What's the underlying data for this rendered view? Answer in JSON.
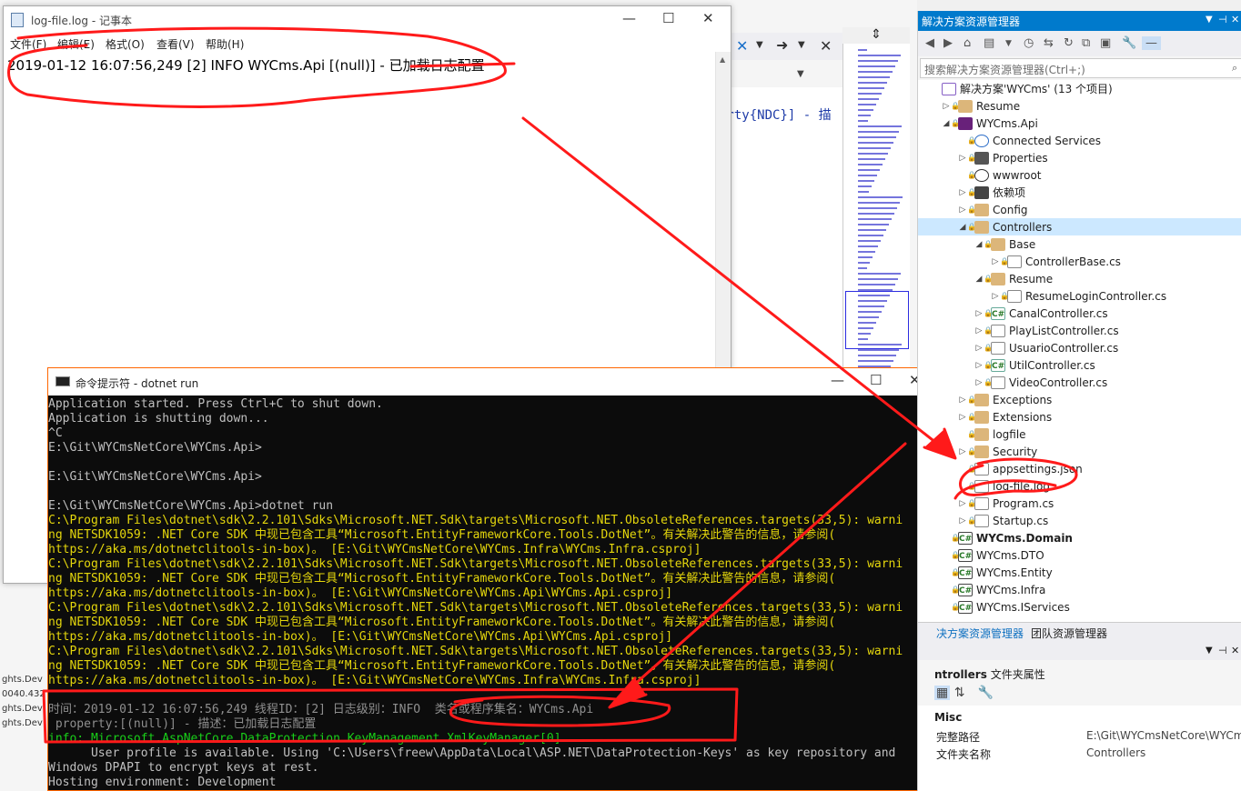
{
  "notepad": {
    "title": "log-file.log - 记事本",
    "menu": [
      "文件(F)",
      "编辑(E)",
      "格式(O)",
      "查看(V)",
      "帮助(H)"
    ],
    "content": "2019-01-12 16:07:56,249 [2] INFO  WYCms.Api [(null)] - 已加载日志配置"
  },
  "editor": {
    "code_fragment": "erty{NDC}] - 描"
  },
  "console": {
    "title": "命令提示符 - dotnet  run",
    "lines": [
      {
        "t": "Application started. Press Ctrl+C to shut down.",
        "c": ""
      },
      {
        "t": "Application is shutting down...",
        "c": ""
      },
      {
        "t": "^C",
        "c": ""
      },
      {
        "t": "E:\\Git\\WYCmsNetCore\\WYCms.Api>",
        "c": ""
      },
      {
        "t": "",
        "c": ""
      },
      {
        "t": "E:\\Git\\WYCmsNetCore\\WYCms.Api>",
        "c": ""
      },
      {
        "t": "",
        "c": ""
      },
      {
        "t": "E:\\Git\\WYCmsNetCore\\WYCms.Api>dotnet run",
        "c": ""
      },
      {
        "t": "C:\\Program Files\\dotnet\\sdk\\2.2.101\\Sdks\\Microsoft.NET.Sdk\\targets\\Microsoft.NET.ObsoleteReferences.targets(33,5): warni",
        "c": "y"
      },
      {
        "t": "ng NETSDK1059: .NET Core SDK 中现已包含工具“Microsoft.EntityFrameworkCore.Tools.DotNet”。有关解决此警告的信息，请参阅(",
        "c": "y"
      },
      {
        "t": "https://aka.ms/dotnetclitools-in-box)。 [E:\\Git\\WYCmsNetCore\\WYCms.Infra\\WYCms.Infra.csproj]",
        "c": "y"
      },
      {
        "t": "C:\\Program Files\\dotnet\\sdk\\2.2.101\\Sdks\\Microsoft.NET.Sdk\\targets\\Microsoft.NET.ObsoleteReferences.targets(33,5): warni",
        "c": "y"
      },
      {
        "t": "ng NETSDK1059: .NET Core SDK 中现已包含工具“Microsoft.EntityFrameworkCore.Tools.DotNet”。有关解决此警告的信息，请参阅(",
        "c": "y"
      },
      {
        "t": "https://aka.ms/dotnetclitools-in-box)。 [E:\\Git\\WYCmsNetCore\\WYCms.Api\\WYCms.Api.csproj]",
        "c": "y"
      },
      {
        "t": "C:\\Program Files\\dotnet\\sdk\\2.2.101\\Sdks\\Microsoft.NET.Sdk\\targets\\Microsoft.NET.ObsoleteReferences.targets(33,5): warni",
        "c": "y"
      },
      {
        "t": "ng NETSDK1059: .NET Core SDK 中现已包含工具“Microsoft.EntityFrameworkCore.Tools.DotNet”。有关解决此警告的信息，请参阅(",
        "c": "y"
      },
      {
        "t": "https://aka.ms/dotnetclitools-in-box)。 [E:\\Git\\WYCmsNetCore\\WYCms.Api\\WYCms.Api.csproj]",
        "c": "y"
      },
      {
        "t": "C:\\Program Files\\dotnet\\sdk\\2.2.101\\Sdks\\Microsoft.NET.Sdk\\targets\\Microsoft.NET.ObsoleteReferences.targets(33,5): warni",
        "c": "y"
      },
      {
        "t": "ng NETSDK1059: .NET Core SDK 中现已包含工具“Microsoft.EntityFrameworkCore.Tools.DotNet”。有关解决此警告的信息，请参阅(",
        "c": "y"
      },
      {
        "t": "https://aka.ms/dotnetclitools-in-box)。 [E:\\Git\\WYCmsNetCore\\WYCms.Infra\\WYCms.Infra.csproj]",
        "c": "y"
      },
      {
        "t": "",
        "c": ""
      },
      {
        "t": "时间：2019-01-12 16:07:56,249 线程ID：[2] 日志级别：INFO  类名或程序集名：WYCms.Api",
        "c": "g"
      },
      {
        "t": " property:[(null)] - 描述：已加载日志配置",
        "c": "g"
      },
      {
        "t": "info: Microsoft.AspNetCore.DataProtection.KeyManagement.XmlKeyManager[0]",
        "c": "gr"
      },
      {
        "t": "      User profile is available. Using 'C:\\Users\\freew\\AppData\\Local\\ASP.NET\\DataProtection-Keys' as key repository and",
        "c": ""
      },
      {
        "t": "Windows DPAPI to encrypt keys at rest.",
        "c": ""
      },
      {
        "t": "Hosting environment: Development",
        "c": ""
      }
    ]
  },
  "solution_explorer": {
    "title": "解决方案资源管理器",
    "search_placeholder": "搜索解决方案资源管理器(Ctrl+;)",
    "items": [
      {
        "label": "解决方案'WYCms' (13 个项目)",
        "icon": "sol",
        "level": 0,
        "arrow": "",
        "bold": false
      },
      {
        "label": "Resume",
        "icon": "folder",
        "level": 1,
        "arrow": "▷",
        "bold": false
      },
      {
        "label": "WYCms.Api",
        "icon": "proj",
        "level": 1,
        "arrow": "◢",
        "bold": false
      },
      {
        "label": "Connected Services",
        "icon": "conn",
        "level": 2,
        "arrow": "",
        "bold": false
      },
      {
        "label": "Properties",
        "icon": "wrench",
        "level": 2,
        "arrow": "▷",
        "bold": false
      },
      {
        "label": "wwwroot",
        "icon": "globe",
        "level": 2,
        "arrow": "",
        "bold": false
      },
      {
        "label": "依赖项",
        "icon": "dep",
        "level": 2,
        "arrow": "▷",
        "bold": false
      },
      {
        "label": "Config",
        "icon": "folder",
        "level": 2,
        "arrow": "▷",
        "bold": false
      },
      {
        "label": "Controllers",
        "icon": "folder",
        "level": 2,
        "arrow": "◢",
        "bold": false,
        "selected": true
      },
      {
        "label": "Base",
        "icon": "folder",
        "level": 3,
        "arrow": "◢",
        "bold": false
      },
      {
        "label": "ControllerBase.cs",
        "icon": "file",
        "level": 4,
        "arrow": "▷",
        "bold": false
      },
      {
        "label": "Resume",
        "icon": "folder",
        "level": 3,
        "arrow": "◢",
        "bold": false
      },
      {
        "label": "ResumeLoginController.cs",
        "icon": "file",
        "level": 4,
        "arrow": "▷",
        "bold": false
      },
      {
        "label": "CanalController.cs",
        "icon": "cs",
        "level": 3,
        "arrow": "▷",
        "bold": false
      },
      {
        "label": "PlayListController.cs",
        "icon": "file",
        "level": 3,
        "arrow": "▷",
        "bold": false
      },
      {
        "label": "UsuarioController.cs",
        "icon": "file",
        "level": 3,
        "arrow": "▷",
        "bold": false
      },
      {
        "label": "UtilController.cs",
        "icon": "cs",
        "level": 3,
        "arrow": "▷",
        "bold": false
      },
      {
        "label": "VideoController.cs",
        "icon": "file",
        "level": 3,
        "arrow": "▷",
        "bold": false
      },
      {
        "label": "Exceptions",
        "icon": "folder",
        "level": 2,
        "arrow": "▷",
        "bold": false
      },
      {
        "label": "Extensions",
        "icon": "folder",
        "level": 2,
        "arrow": "▷",
        "bold": false
      },
      {
        "label": "logfile",
        "icon": "folder",
        "level": 2,
        "arrow": "",
        "bold": false
      },
      {
        "label": "Security",
        "icon": "folder",
        "level": 2,
        "arrow": "▷",
        "bold": false
      },
      {
        "label": "appsettings.json",
        "icon": "file",
        "level": 2,
        "arrow": "",
        "bold": false
      },
      {
        "label": "log-file.log",
        "icon": "file",
        "level": 2,
        "arrow": "",
        "bold": false
      },
      {
        "label": "Program.cs",
        "icon": "file",
        "level": 2,
        "arrow": "▷",
        "bold": false
      },
      {
        "label": "Startup.cs",
        "icon": "file",
        "level": 2,
        "arrow": "▷",
        "bold": false
      },
      {
        "label": "WYCms.Domain",
        "icon": "lib",
        "level": 1,
        "arrow": "",
        "bold": true
      },
      {
        "label": "WYCms.DTO",
        "icon": "lib",
        "level": 1,
        "arrow": "",
        "bold": false
      },
      {
        "label": "WYCms.Entity",
        "icon": "lib",
        "level": 1,
        "arrow": "",
        "bold": false
      },
      {
        "label": "WYCms.Infra",
        "icon": "lib",
        "level": 1,
        "arrow": "",
        "bold": false
      },
      {
        "label": "WYCms.IServices",
        "icon": "lib",
        "level": 1,
        "arrow": "",
        "bold": false
      }
    ],
    "tabs": [
      "决方案资源管理器",
      "团队资源管理器"
    ]
  },
  "properties": {
    "object_name": "ntrollers",
    "object_type": "文件夹属性",
    "category": "Misc",
    "rows": [
      {
        "k": "完整路径",
        "v": "E:\\Git\\WYCmsNetCore\\WYCm"
      },
      {
        "k": "文件夹名称",
        "v": "Controllers"
      }
    ]
  },
  "left_strip": [
    "ghts.Dev",
    "0040.432",
    "ghts.Dev",
    "ghts.Dev"
  ],
  "colors": {
    "accent": "#007acc",
    "annotation": "#ff1a1a",
    "console_warning": "#e5d70c"
  }
}
